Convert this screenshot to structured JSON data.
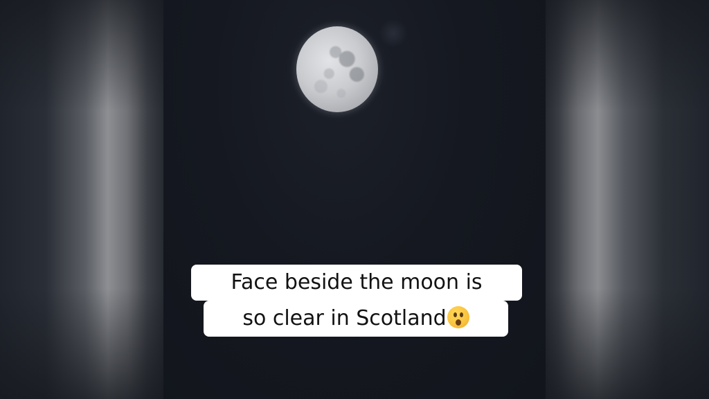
{
  "caption": {
    "line1": "Face beside the moon is",
    "line2": "so clear in Scotland",
    "emoji": "astonished-face-emoji"
  },
  "colors": {
    "sky": "#151820",
    "caption_background": "#ffffff",
    "caption_text": "#121212",
    "side_panels": "#8d8f93"
  }
}
